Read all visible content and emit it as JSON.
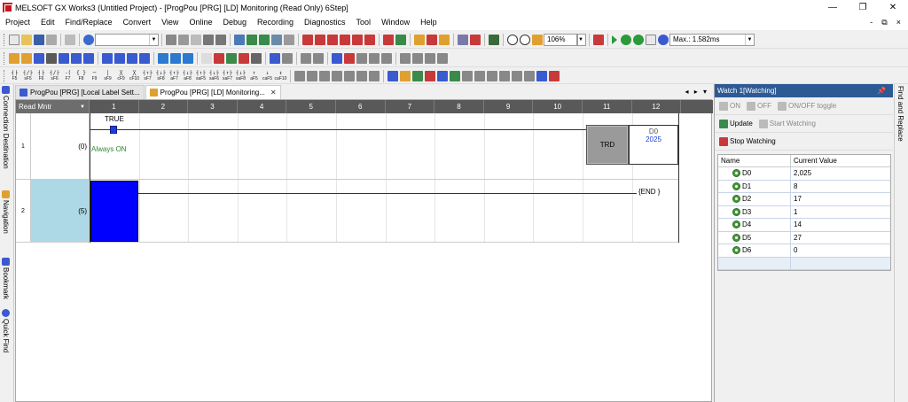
{
  "window": {
    "title": "MELSOFT GX Works3 (Untitled Project) - [ProgPou [PRG] [LD] Monitoring (Read Only) 6Step]",
    "minimize": "—",
    "restore": "❐",
    "close": "✕"
  },
  "menu": {
    "items": [
      "Project",
      "Edit",
      "Find/Replace",
      "Convert",
      "View",
      "Online",
      "Debug",
      "Recording",
      "Diagnostics",
      "Tool",
      "Window",
      "Help"
    ],
    "right_controls": [
      "-",
      "⧉",
      "×"
    ]
  },
  "toolbar": {
    "zoom": "106%",
    "max_scan": "Max.: 1.582ms",
    "fkeys": [
      {
        "glyph": "┤├",
        "label": "F5"
      },
      {
        "glyph": "┤/├",
        "label": "sF5"
      },
      {
        "glyph": "┤├",
        "label": "F6"
      },
      {
        "glyph": "┤/├",
        "label": "sF6"
      },
      {
        "glyph": "-( )",
        "label": "F7"
      },
      {
        "glyph": "{ }",
        "label": "F8"
      },
      {
        "glyph": "─",
        "label": "F9"
      },
      {
        "glyph": "│",
        "label": "sF9"
      },
      {
        "glyph": "╳",
        "label": "cF9"
      },
      {
        "glyph": "╳",
        "label": "cF10"
      },
      {
        "glyph": "┤↑├",
        "label": "sF7"
      },
      {
        "glyph": "┤↓├",
        "label": "sF8"
      },
      {
        "glyph": "┤↑├",
        "label": "aF7"
      },
      {
        "glyph": "┤↓├",
        "label": "aF8"
      },
      {
        "glyph": "┤↑├",
        "label": "saF5"
      },
      {
        "glyph": "┤↓├",
        "label": "saF6"
      },
      {
        "glyph": "┤↑├",
        "label": "saF7"
      },
      {
        "glyph": "┤↓├",
        "label": "saF8"
      },
      {
        "glyph": "↑",
        "label": "aF5"
      },
      {
        "glyph": "↓",
        "label": "caF5"
      },
      {
        "glyph": "↕",
        "label": "caF10"
      }
    ]
  },
  "docks": {
    "left": [
      "Connection Destination",
      "Navigation",
      "Bookmark",
      "Quick Find"
    ],
    "right": [
      "Find and Replace"
    ]
  },
  "tabs": [
    {
      "label": "ProgPou [PRG] [Local Label Sett...",
      "active": false
    },
    {
      "label": "ProgPou [PRG] [LD] Monitoring...",
      "active": true,
      "close": "✕"
    }
  ],
  "tab_nav": "◂ ▸ ▾",
  "ladder": {
    "mode": "Read Mntr",
    "columns": [
      "1",
      "2",
      "3",
      "4",
      "5",
      "6",
      "7",
      "8",
      "9",
      "10",
      "11",
      "12"
    ],
    "rungs": [
      {
        "number": "1",
        "step": "(0)",
        "contact_label": "TRUE",
        "comment": "Always ON",
        "instruction": "TRD",
        "operand_device": "D0",
        "operand_value": "2025"
      },
      {
        "number": "2",
        "step": "(5)",
        "end": "{END }"
      }
    ]
  },
  "watch": {
    "title": "Watch 1[Watching]",
    "pin": "📌",
    "buttons": {
      "on": "ON",
      "off": "OFF",
      "toggle": "ON/OFF toggle",
      "update": "Update",
      "start": "Start Watching",
      "stop": "Stop Watching"
    },
    "columns": {
      "name": "Name",
      "value": "Current Value"
    },
    "rows": [
      {
        "name": "D0",
        "value": "2,025"
      },
      {
        "name": "D1",
        "value": "8"
      },
      {
        "name": "D2",
        "value": "17"
      },
      {
        "name": "D3",
        "value": "1"
      },
      {
        "name": "D4",
        "value": "14"
      },
      {
        "name": "D5",
        "value": "27"
      },
      {
        "name": "D6",
        "value": "0"
      }
    ]
  },
  "colors": {
    "selection": "#0000ff",
    "monitor_cell": "#add8e6",
    "watch_header": "#2d5a94",
    "ruler": "#595959"
  }
}
